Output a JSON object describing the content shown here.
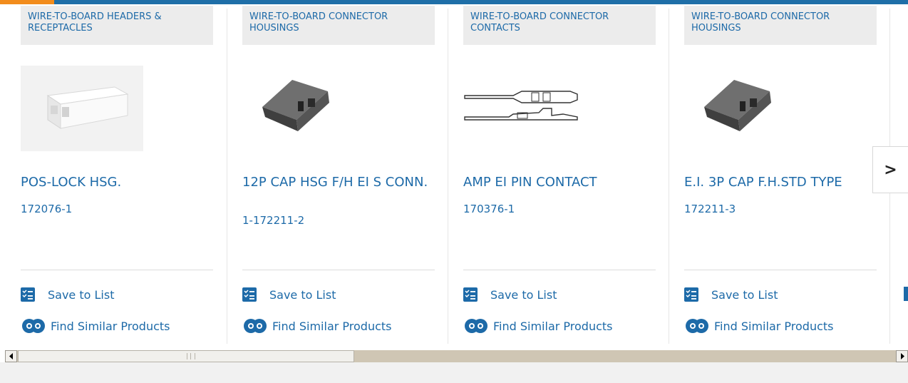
{
  "carousel": {
    "cards": [
      {
        "category": "WIRE-TO-BOARD HEADERS & RECEPTACLES",
        "title": "POS-LOCK HSG.",
        "part_number": "172076-1"
      },
      {
        "category": "WIRE-TO-BOARD CONNECTOR HOUSINGS",
        "title": "12P CAP HSG F/H EI S CONN.",
        "part_number": "1-172211-2"
      },
      {
        "category": "WIRE-TO-BOARD CONNECTOR CONTACTS",
        "title": "AMP EI PIN CONTACT",
        "part_number": "170376-1"
      },
      {
        "category": "WIRE-TO-BOARD CONNECTOR HOUSINGS",
        "title": "E.I. 3P CAP F.H.STD TYPE",
        "part_number": "172211-3"
      }
    ],
    "actions": {
      "save_label": "Save to List",
      "similar_label": "Find Similar Products"
    },
    "next_icon": "chevron-right-icon"
  },
  "colors": {
    "link": "#1d6aa8",
    "top_bar": "#1f6fa8",
    "top_accent": "#f28c1c",
    "category_bg": "#ececec"
  }
}
